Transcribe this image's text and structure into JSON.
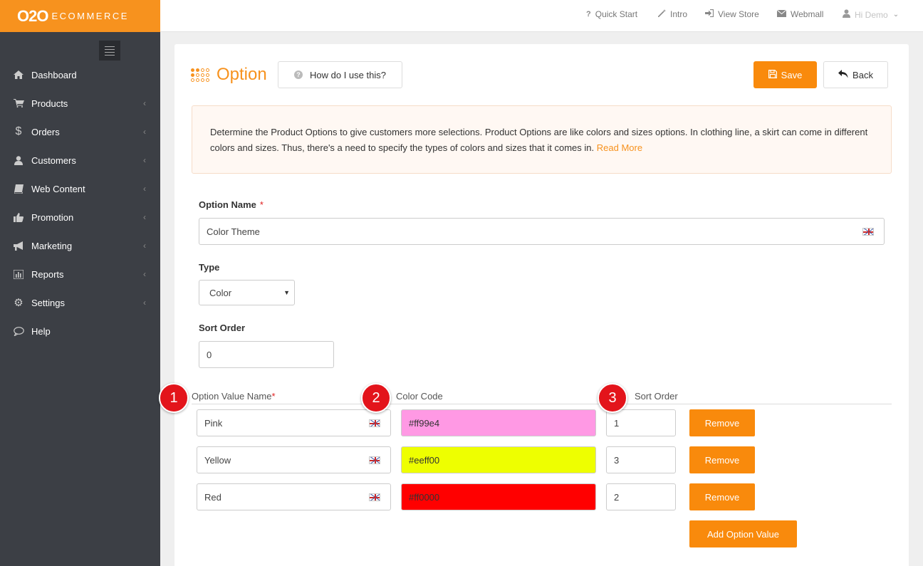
{
  "brand": {
    "logo_main": "O2O",
    "logo_sub": "ECOMMERCE",
    "accent": "#f7921e"
  },
  "sidebar": {
    "items": [
      {
        "label": "Dashboard",
        "icon": "home-icon"
      },
      {
        "label": "Products",
        "icon": "cart-icon",
        "has_submenu": true
      },
      {
        "label": "Orders",
        "icon": "dollar-icon",
        "has_submenu": true
      },
      {
        "label": "Customers",
        "icon": "user-icon",
        "has_submenu": true
      },
      {
        "label": "Web Content",
        "icon": "book-icon",
        "has_submenu": true
      },
      {
        "label": "Promotion",
        "icon": "thumbs-up-icon",
        "has_submenu": true
      },
      {
        "label": "Marketing",
        "icon": "megaphone-icon",
        "has_submenu": true
      },
      {
        "label": "Reports",
        "icon": "bar-chart-icon",
        "has_submenu": true
      },
      {
        "label": "Settings",
        "icon": "gears-icon",
        "has_submenu": true
      },
      {
        "label": "Help",
        "icon": "speech-bubble-icon"
      }
    ]
  },
  "topbar": {
    "quick_start": "Quick Start",
    "intro": "Intro",
    "view_store": "View Store",
    "webmall": "Webmall",
    "user": "Hi Demo"
  },
  "page": {
    "title": "Option",
    "how_label": "How do I use this?",
    "save_label": "Save",
    "back_label": "Back",
    "info_text": "Determine the Product Options to give customers more selections. Product Options are like colors and sizes options. In clothing line, a skirt can come in different colors and sizes. Thus, there's a need to specify the types of colors and sizes that it comes in.",
    "read_more": "Read More"
  },
  "form": {
    "option_name_label": "Option Name",
    "required_mark": "*",
    "option_name_value": "Color Theme",
    "type_label": "Type",
    "type_value": "Color",
    "sort_order_label": "Sort Order",
    "sort_order_value": "0"
  },
  "option_values": {
    "col_name": "Option Value Name",
    "col_color": "Color Code",
    "col_sort": "Sort Order",
    "remove_label": "Remove",
    "add_label": "Add Option Value",
    "rows": [
      {
        "name": "Pink",
        "color": "#ff99e4",
        "sort": "1"
      },
      {
        "name": "Yellow",
        "color": "#eeff00",
        "sort": "3"
      },
      {
        "name": "Red",
        "color": "#ff0000",
        "sort": "2"
      }
    ]
  },
  "badges": [
    "1",
    "2",
    "3"
  ]
}
